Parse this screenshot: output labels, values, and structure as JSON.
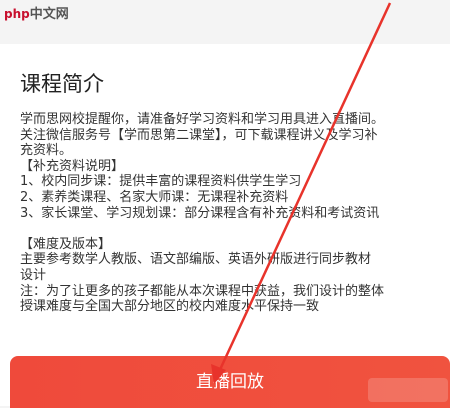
{
  "watermark": {
    "brand": "php",
    "text": "中文网"
  },
  "section": {
    "title": "课程简介"
  },
  "content": {
    "lines": [
      "学而思网校提醒你，请准备好学习资料和学习用具进入直播间。",
      "关注微信服务号【学而思第二课堂】，可下载课程讲义及学习补",
      "充资料。",
      "【补充资料说明】",
      "1、校内同步课：提供丰富的课程资料供学生学习",
      "2、素养类课程、名家大师课：无课程补充资料",
      "3、家长课堂、学习规划课：部分课程含有补充资料和考试资讯",
      "",
      "【难度及版本】",
      "主要参考数学人教版、语文部编版、英语外研版进行同步教材",
      "设计",
      "注：为了让更多的孩子都能从本次课程中获益，我们设计的整体",
      "授课难度与全国大部分地区的校内难度水平保持一致"
    ]
  },
  "button": {
    "label": "直播回放"
  },
  "colors": {
    "accent": "#ef4a3b",
    "arrow": "#e8332b"
  }
}
